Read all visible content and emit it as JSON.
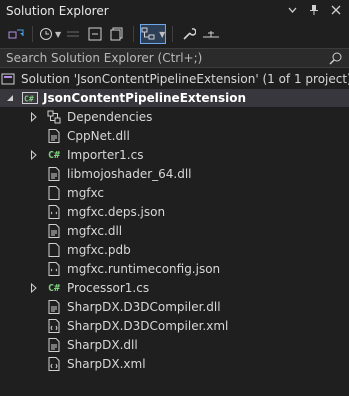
{
  "panel": {
    "title": "Solution Explorer"
  },
  "search": {
    "placeholder": "Search Solution Explorer (Ctrl+;)"
  },
  "solution": {
    "label": "Solution 'JsonContentPipelineExtension' (1 of 1 project)"
  },
  "project": {
    "label": "JsonContentPipelineExtension"
  },
  "items": [
    {
      "label": "Dependencies",
      "icon": "dependencies-icon",
      "expandable": true
    },
    {
      "label": "CppNet.dll",
      "icon": "dll-file-icon",
      "expandable": false
    },
    {
      "label": "Importer1.cs",
      "icon": "csharp-file-icon",
      "expandable": true
    },
    {
      "label": "libmojoshader_64.dll",
      "icon": "dll-file-icon",
      "expandable": false
    },
    {
      "label": "mgfxc",
      "icon": "file-icon",
      "expandable": false
    },
    {
      "label": "mgfxc.deps.json",
      "icon": "json-file-icon",
      "expandable": false
    },
    {
      "label": "mgfxc.dll",
      "icon": "dll-file-icon",
      "expandable": false
    },
    {
      "label": "mgfxc.pdb",
      "icon": "file-icon",
      "expandable": false
    },
    {
      "label": "mgfxc.runtimeconfig.json",
      "icon": "json-file-icon",
      "expandable": false
    },
    {
      "label": "Processor1.cs",
      "icon": "csharp-file-icon",
      "expandable": true
    },
    {
      "label": "SharpDX.D3DCompiler.dll",
      "icon": "dll-file-icon",
      "expandable": false
    },
    {
      "label": "SharpDX.D3DCompiler.xml",
      "icon": "xml-file-icon",
      "expandable": false
    },
    {
      "label": "SharpDX.dll",
      "icon": "dll-file-icon",
      "expandable": false
    },
    {
      "label": "SharpDX.xml",
      "icon": "xml-file-icon",
      "expandable": false
    }
  ],
  "csharp_badge": "C#",
  "colors": {
    "background": "#1f1f1f",
    "selection": "#37373d",
    "accent": "#6fa7e8",
    "csharp": "#7fd07f"
  }
}
